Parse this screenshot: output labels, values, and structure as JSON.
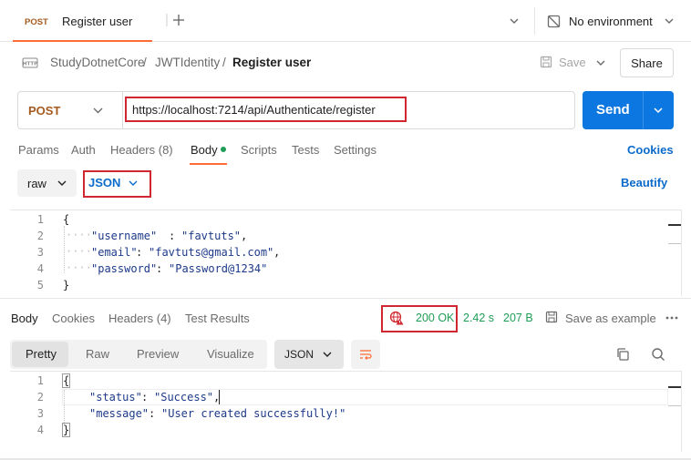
{
  "tab": {
    "method": "POST",
    "title": "Register user"
  },
  "environment": {
    "label": "No environment"
  },
  "breadcrumb": {
    "collection": "StudyDotnetCore",
    "folder": "JWTIdentity",
    "request": "Register user",
    "separator": "/"
  },
  "toolbar": {
    "save_label": "Save",
    "share_label": "Share"
  },
  "request": {
    "method": "POST",
    "url": "https://localhost:7214/api/Authenticate/register",
    "send_label": "Send",
    "tabs": {
      "params": "Params",
      "auth": "Auth",
      "headers": "Headers (8)",
      "body": "Body",
      "scripts": "Scripts",
      "tests": "Tests",
      "settings": "Settings"
    },
    "cookies_label": "Cookies",
    "body_mode": "raw",
    "body_format": "JSON",
    "beautify_label": "Beautify",
    "body_lines": {
      "n1": "1",
      "n2": "2",
      "n3": "3",
      "n4": "4",
      "n5": "5",
      "l1": "{",
      "k2": "\"username\"",
      "v2": "\"favtuts\"",
      "k3": "\"email\"",
      "v3": "\"favtuts@gmail.com\"",
      "k4": "\"password\"",
      "v4": "\"Password@1234\"",
      "l5": "}"
    }
  },
  "response": {
    "tabs": {
      "body": "Body",
      "cookies": "Cookies",
      "headers": "Headers (4)",
      "test_results": "Test Results"
    },
    "status": "200 OK",
    "time": "2.42 s",
    "size": "207 B",
    "save_example_label": "Save as example",
    "views": {
      "pretty": "Pretty",
      "raw": "Raw",
      "preview": "Preview",
      "visualize": "Visualize"
    },
    "format": "JSON",
    "body_lines": {
      "n1": "1",
      "n2": "2",
      "n3": "3",
      "n4": "4",
      "l1": "{",
      "k2": "\"status\"",
      "v2": "\"Success\"",
      "k3": "\"message\"",
      "v3": "\"User created successfully!\"",
      "l4": "}"
    }
  },
  "colors": {
    "accent": "#ff6c37",
    "send": "#0c77e0",
    "link": "#0b6bcb",
    "success": "#1f9d55",
    "highlight": "#d0262f",
    "method": "#a55a1e"
  }
}
